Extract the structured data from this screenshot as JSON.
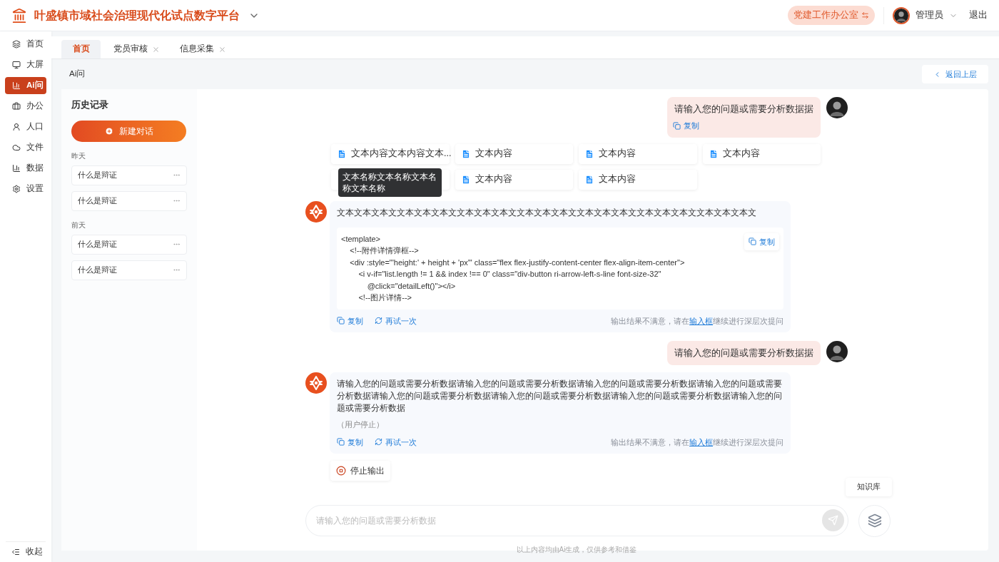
{
  "header": {
    "title": "叶盛镇市域社会治理现代化试点数字平台",
    "office_switch": {
      "label": "党建工作办公室",
      "active": true
    },
    "user": "管理员",
    "logout": "退出"
  },
  "nav": {
    "items": [
      {
        "label": "首页",
        "selected": false
      },
      {
        "label": "大屏",
        "selected": false
      },
      {
        "label": "Ai问",
        "selected": true
      },
      {
        "label": "办公",
        "selected": false
      },
      {
        "label": "人口",
        "selected": false
      },
      {
        "label": "文件",
        "selected": false
      },
      {
        "label": "数据",
        "selected": false
      },
      {
        "label": "设置",
        "selected": false
      }
    ],
    "collapse": "收起"
  },
  "tabs": [
    {
      "label": "首页",
      "selected": true,
      "closable": false
    },
    {
      "label": "党员审核",
      "selected": false,
      "closable": true
    },
    {
      "label": "信息采集",
      "selected": false,
      "closable": true
    }
  ],
  "breadcrumb": "Ai问",
  "back_button": "返回上层",
  "history": {
    "title": "历史记录",
    "new_button": "新建对话",
    "groups": [
      {
        "label": "昨天",
        "items": [
          "什么是辩证",
          "什么是辩证"
        ]
      },
      {
        "label": "前天",
        "items": [
          "什么是辩证",
          "什么是辩证"
        ]
      }
    ]
  },
  "messages": [
    {
      "kind": "user",
      "text": "请输入您的问题或需要分析数据据",
      "copy": "复制"
    },
    {
      "kind": "attachments",
      "files": [
        {
          "label": "文本内容文本内容文本...",
          "tooltip": "文本名称文本名称文本名称文本名称"
        },
        {
          "label": "文本内容"
        },
        {
          "label": "文本内容"
        },
        {
          "label": "文本内容"
        },
        {
          "covered": true
        },
        {
          "label": "文本内容"
        },
        {
          "label": "文本内容"
        }
      ]
    },
    {
      "kind": "ai",
      "text": "文本文本文本文文本文本文本文文本文本文本文文本文本文本文文本文本文本文文本文本文本文文本文本文本文",
      "code": {
        "lines": [
          "<template>",
          "    <!--附件详情弹框-->",
          "    <div :style=\"'height:' + height + 'px'\" class=\"flex flex-justify-content-center flex-align-item-center\">",
          "        <i v-if=\"list.length != 1 && index !== 0\" class=\"div-button ri-arrow-left-s-line font-size-32\"",
          "            @click=\"detailLeft()\"></i>",
          "        <!--图片详情-->"
        ],
        "copy": "复制"
      },
      "actions": [
        "复制",
        "再试一次"
      ],
      "hint": {
        "before": "输出结果不满意，请在",
        "link": "输入框",
        "after": "继续进行深层次提问"
      }
    },
    {
      "kind": "user",
      "text": "请输入您的问题或需要分析数据据"
    },
    {
      "kind": "ai",
      "text": "请输入您的问题或需要分析数据请输入您的问题或需要分析数据请输入您的问题或需要分析数据请输入您的问题或需要分析数据请输入您的问题或需要分析数据请输入您的问题或需要分析数据请输入您的问题或需要分析数据请输入您的问题或需要分析数据",
      "status": "（用户停止）",
      "actions": [
        "复制",
        "再试一次"
      ],
      "hint": {
        "before": "输出结果不满意，请在",
        "link": "输入框",
        "after": "继续进行深层次提问"
      }
    }
  ],
  "stop_button": "停止输出",
  "input": {
    "placeholder": "请输入您的问题或需要分析数据",
    "send_disabled": true,
    "knowledge_tip": "知识库"
  },
  "disclaimer": "以上内容均由Ai生成，仅供参考和借鉴"
}
